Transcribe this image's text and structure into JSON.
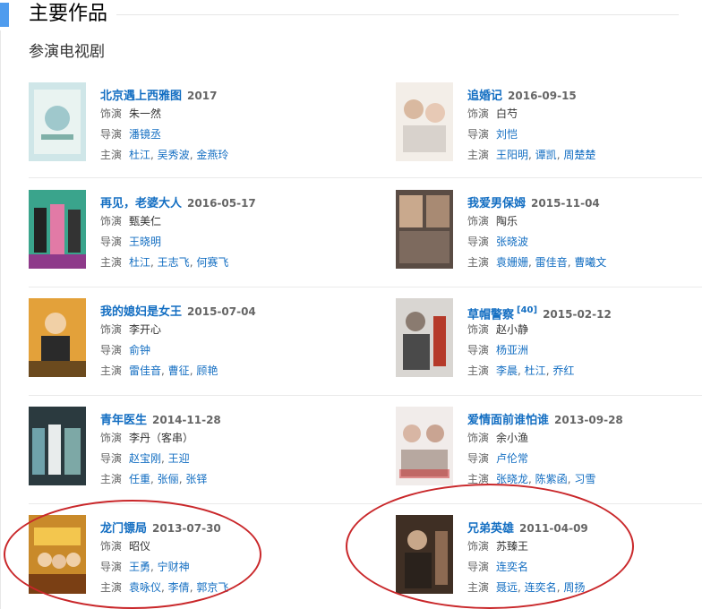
{
  "section": {
    "title": "主要作品",
    "subtitle": "参演电视剧"
  },
  "labels": {
    "role": "饰演",
    "director": "导演",
    "cast": "主演"
  },
  "works": [
    {
      "name": "北京遇上西雅图",
      "date": "2017",
      "role": "朱一然",
      "directors": [
        "潘镜丞"
      ],
      "cast": [
        "杜江",
        "吴秀波",
        "金燕玲"
      ]
    },
    {
      "name": "追婚记",
      "date": "2016-09-15",
      "role": "白芍",
      "directors": [
        "刘恺"
      ],
      "cast": [
        "王阳明",
        "谭凯",
        "周楚楚"
      ]
    },
    {
      "name": "再见，老婆大人",
      "date": "2016-05-17",
      "role": "甄美仁",
      "directors": [
        "王晓明"
      ],
      "cast": [
        "杜江",
        "王志飞",
        "何赛飞"
      ]
    },
    {
      "name": "我爱男保姆",
      "date": "2015-11-04",
      "role": "陶乐",
      "directors": [
        "张晓波"
      ],
      "cast": [
        "袁姗姗",
        "雷佳音",
        "曹曦文"
      ]
    },
    {
      "name": "我的媳妇是女王",
      "date": "2015-07-04",
      "role": "李开心",
      "directors": [
        "俞钟"
      ],
      "cast": [
        "雷佳音",
        "曹征",
        "顾艳"
      ]
    },
    {
      "name": "草帽警察",
      "sup": "[40]",
      "date": "2015-02-12",
      "role": "赵小静",
      "directors": [
        "杨亚洲"
      ],
      "cast": [
        "李晨",
        "杜江",
        "乔红"
      ]
    },
    {
      "name": "青年医生",
      "date": "2014-11-28",
      "role": "李丹（客串）",
      "directors": [
        "赵宝刚",
        "王迎"
      ],
      "cast": [
        "任重",
        "张俪",
        "张铎"
      ]
    },
    {
      "name": "爱情面前谁怕谁",
      "date": "2013-09-28",
      "role": "余小渔",
      "directors": [
        "卢伦常"
      ],
      "cast": [
        "张晓龙",
        "陈紫函",
        "习雪"
      ]
    },
    {
      "name": "龙门镖局",
      "date": "2013-07-30",
      "role": "昭仪",
      "directors": [
        "王勇",
        "宁财神"
      ],
      "cast": [
        "袁咏仪",
        "李倩",
        "郭京飞"
      ]
    },
    {
      "name": "兄弟英雄",
      "date": "2011-04-09",
      "role": "苏臻王",
      "directors": [
        "连奕名"
      ],
      "cast": [
        "聂远",
        "连奕名",
        "周扬"
      ]
    }
  ],
  "colors": {
    "link": "#136ec2",
    "accent_bar": "#4f9cee",
    "annotation": "#c9272a"
  }
}
